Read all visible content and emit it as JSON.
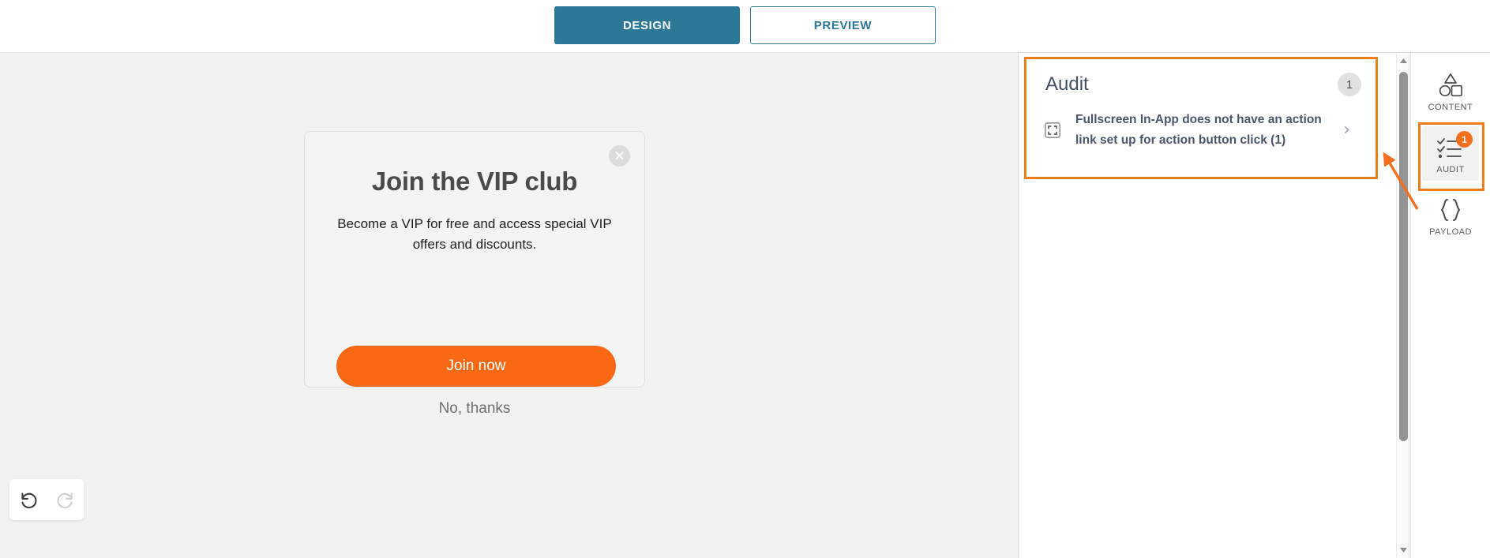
{
  "header": {
    "tabs": [
      {
        "label": "DESIGN",
        "state": "active"
      },
      {
        "label": "PREVIEW",
        "state": "inactive"
      }
    ]
  },
  "canvas": {
    "modal": {
      "title": "Join the VIP club",
      "body": "Become a VIP for free and access special VIP offers and discounts.",
      "cta_label": "Join now",
      "dismiss_label": "No, thanks",
      "close_icon": "×",
      "cta_color": "#f96815",
      "background": "#f4f4f4"
    },
    "history": {
      "undo_icon": "undo-icon",
      "redo_icon": "redo-icon",
      "undo_state": "enabled",
      "redo_state": "disabled"
    },
    "background": "#f2f2f0"
  },
  "audit_panel": {
    "title": "Audit",
    "count": "1",
    "highlight_color": "#ef7d1a",
    "items": [
      {
        "icon": "fullscreen-icon",
        "text": "Fullscreen In-App does not have an action link set up for action button click (1)",
        "chevron": "›"
      }
    ]
  },
  "scrollbar": {
    "up_arrow": "scroll-up-icon",
    "down_arrow": "scroll-down-icon"
  },
  "rail": {
    "items": [
      {
        "label": "CONTENT",
        "icon": "shapes-icon",
        "selected": false,
        "badge": null
      },
      {
        "label": "AUDIT",
        "icon": "checklist-icon",
        "selected": true,
        "badge": "1"
      },
      {
        "label": "PAYLOAD",
        "icon": "braces-icon",
        "selected": false,
        "badge": null
      }
    ],
    "badge_color": "#f4701f"
  }
}
